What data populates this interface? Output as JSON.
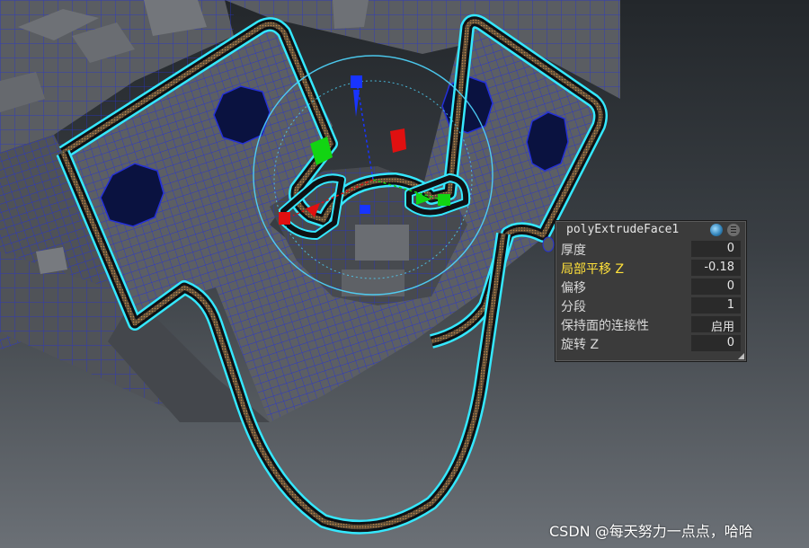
{
  "panel": {
    "title": "polyExtrudeFace1",
    "globe_icon": "globe-icon",
    "menu_icon": "menu-icon",
    "rows": [
      {
        "label": "厚度",
        "value": "0",
        "selected": false
      },
      {
        "label": "局部平移 Z",
        "value": "-0.18",
        "selected": true
      },
      {
        "label": "偏移",
        "value": "0",
        "selected": false
      },
      {
        "label": "分段",
        "value": "1",
        "selected": false
      },
      {
        "label": "保持面的连接性",
        "value": "启用",
        "selected": false
      },
      {
        "label": "旋转 Z",
        "value": "0",
        "selected": false
      }
    ]
  },
  "watermark": "CSDN @每天努力一点点，哈哈",
  "colors": {
    "wire": "#1e2bd6",
    "highlight": "#35e8ff",
    "label_selected": "#ffe13a",
    "axis_x": "#e01010",
    "axis_y": "#12d412",
    "axis_z": "#1834ff"
  }
}
